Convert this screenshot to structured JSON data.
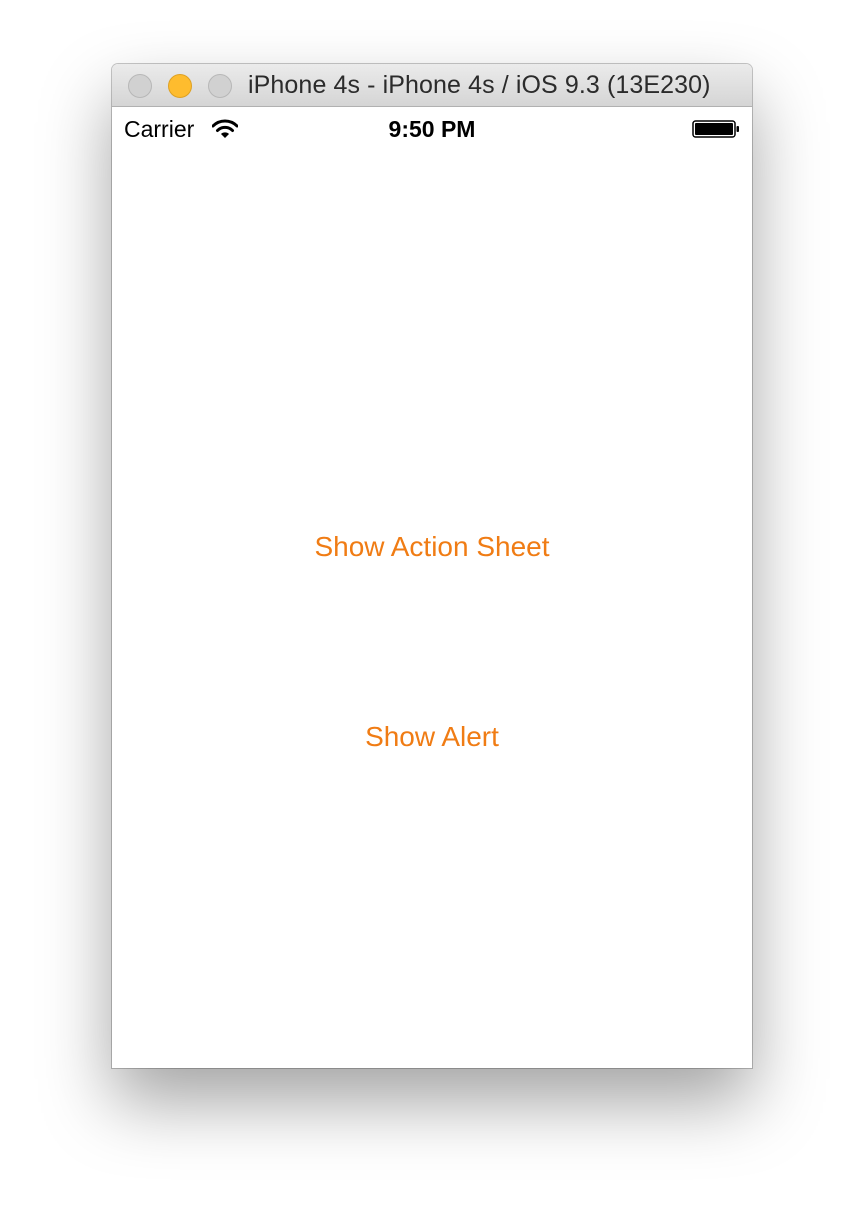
{
  "window": {
    "title": "iPhone 4s - iPhone 4s / iOS 9.3 (13E230)"
  },
  "status_bar": {
    "carrier": "Carrier",
    "time": "9:50 PM",
    "icons": [
      "wifi-icon",
      "battery-icon"
    ]
  },
  "main": {
    "action_sheet_label": "Show Action Sheet",
    "alert_label": "Show Alert"
  },
  "colors": {
    "tint": "#f07c14",
    "traffic_minimize": "#febc2e"
  }
}
